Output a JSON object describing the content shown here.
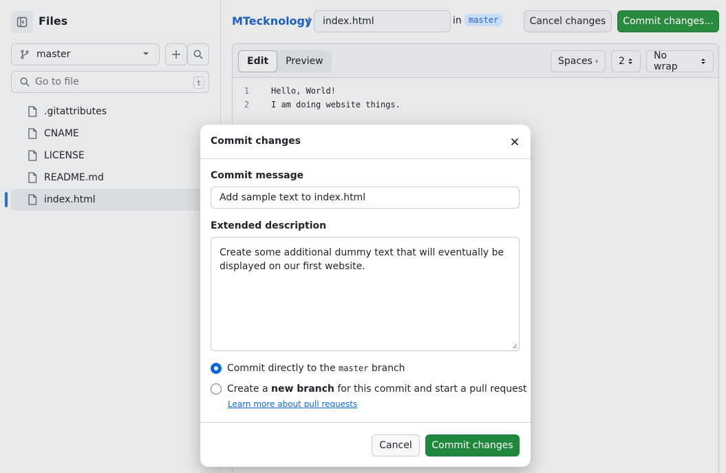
{
  "sidebar": {
    "title": "Files",
    "branch": "master",
    "search_placeholder": "Go to file",
    "search_shortcut": "t",
    "files": [
      ".gitattributes",
      "CNAME",
      "LICENSE",
      "README.md",
      "index.html"
    ],
    "active_file": "index.html"
  },
  "header": {
    "repo": "MTecknology",
    "separator": "/",
    "filename": "index.html",
    "in_label": "in",
    "branch": "master",
    "cancel_label": "Cancel changes",
    "commit_label": "Commit changes..."
  },
  "editor": {
    "tab_edit": "Edit",
    "tab_preview": "Preview",
    "indent_mode": "Spaces",
    "indent_size": "2",
    "wrap_mode": "No wrap",
    "lines": [
      {
        "num": "1",
        "text": "Hello, World!"
      },
      {
        "num": "2",
        "text": "I am doing website things."
      }
    ]
  },
  "modal": {
    "title": "Commit changes",
    "message_label": "Commit message",
    "message_value": "Add sample text to index.html",
    "description_label": "Extended description",
    "description_value": "Create some additional dummy text that will eventually be displayed on our first website.",
    "option_direct_pre": "Commit directly to the",
    "option_direct_branch": "master",
    "option_direct_post": "branch",
    "option_new_pre": "Create a",
    "option_new_bold": "new branch",
    "option_new_post": "for this commit and start a pull request",
    "learn_more": "Learn more about pull requests",
    "cancel_label": "Cancel",
    "commit_label": "Commit changes"
  },
  "colors": {
    "accent_blue": "#0969da",
    "commit_green": "#1f883d",
    "branch_tag_bg": "#c9dcf5"
  }
}
